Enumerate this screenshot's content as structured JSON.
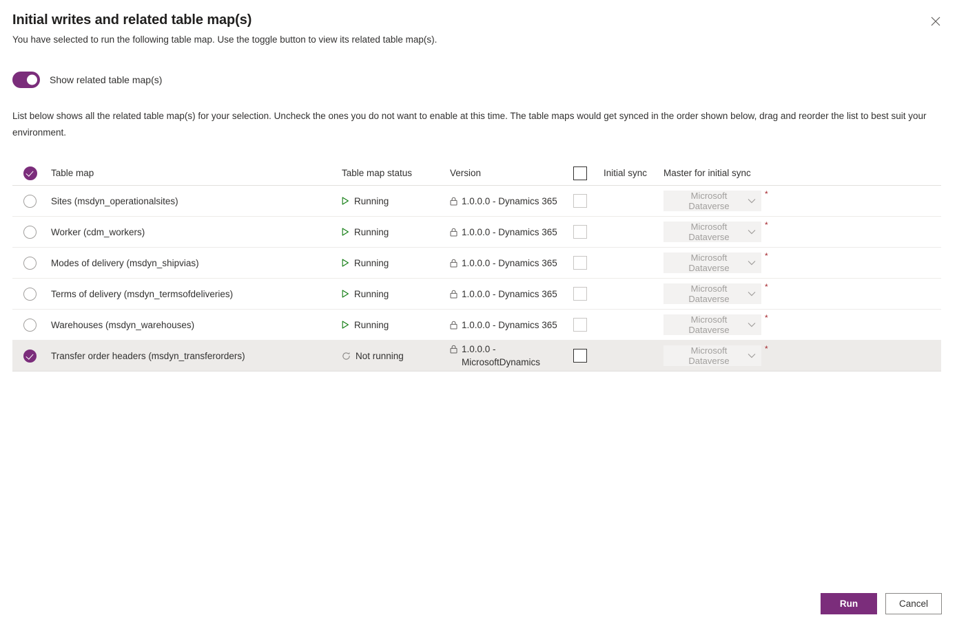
{
  "header": {
    "title": "Initial writes and related table map(s)",
    "subtitle": "You have selected to run the following table map. Use the toggle button to view its related table map(s).",
    "close_label": "Close"
  },
  "toggle": {
    "label": "Show related table map(s)",
    "state": "on"
  },
  "intro": "List below shows all the related table map(s) for your selection. Uncheck the ones you do not want to enable at this time. The table maps would get synced in the order shown below, drag and reorder the list to best suit your environment.",
  "table": {
    "columns": {
      "table_map": "Table map",
      "status": "Table map status",
      "version": "Version",
      "initial_sync": "Initial sync",
      "master": "Master for initial sync"
    },
    "rows": [
      {
        "name": "Sites (msdyn_operationalsites)",
        "status": "Running",
        "status_icon": "play-icon",
        "version": "1.0.0.0 - Dynamics 365",
        "selected": false,
        "initial_sync_checked": false,
        "master": "Microsoft Dataverse",
        "required": "*"
      },
      {
        "name": "Worker (cdm_workers)",
        "status": "Running",
        "status_icon": "play-icon",
        "version": "1.0.0.0 - Dynamics 365",
        "selected": false,
        "initial_sync_checked": false,
        "master": "Microsoft Dataverse",
        "required": "*"
      },
      {
        "name": "Modes of delivery (msdyn_shipvias)",
        "status": "Running",
        "status_icon": "play-icon",
        "version": "1.0.0.0 - Dynamics 365",
        "selected": false,
        "initial_sync_checked": false,
        "master": "Microsoft Dataverse",
        "required": "*"
      },
      {
        "name": "Terms of delivery (msdyn_termsofdeliveries)",
        "status": "Running",
        "status_icon": "play-icon",
        "version": "1.0.0.0 - Dynamics 365",
        "selected": false,
        "initial_sync_checked": false,
        "master": "Microsoft Dataverse",
        "required": "*"
      },
      {
        "name": "Warehouses (msdyn_warehouses)",
        "status": "Running",
        "status_icon": "play-icon",
        "version": "1.0.0.0 - Dynamics 365",
        "selected": false,
        "initial_sync_checked": false,
        "master": "Microsoft Dataverse",
        "required": "*"
      },
      {
        "name": "Transfer order headers (msdyn_transferorders)",
        "status": "Not running",
        "status_icon": "not-running-icon",
        "version": "1.0.0.0 - MicrosoftDynamics",
        "selected": true,
        "initial_sync_checked": false,
        "master": "Microsoft Dataverse",
        "required": "*"
      }
    ]
  },
  "footer": {
    "run_label": "Run",
    "cancel_label": "Cancel"
  },
  "colors": {
    "accent_purple": "#7b2d7b",
    "status_running_green": "#107c10",
    "required_red": "#a4262c",
    "selected_row_bg": "#edebe9"
  }
}
